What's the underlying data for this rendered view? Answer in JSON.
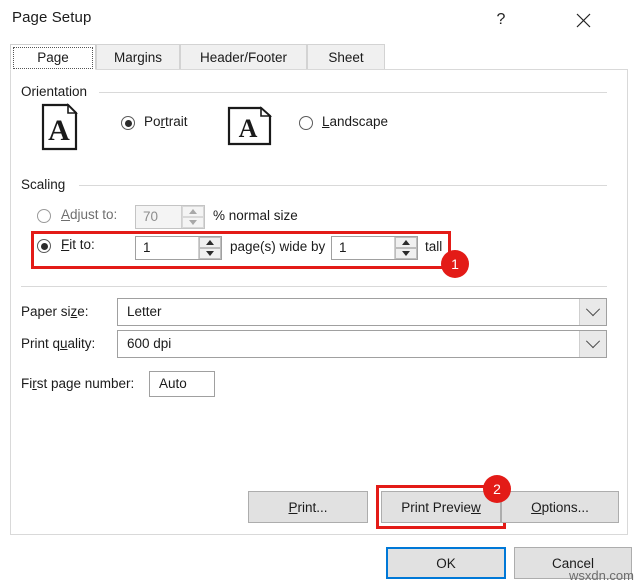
{
  "window": {
    "title": "Page Setup",
    "help_icon": "question-mark-icon",
    "close_icon": "close-icon"
  },
  "tabs": [
    {
      "label": "Page",
      "active": true
    },
    {
      "label": "Margins",
      "active": false
    },
    {
      "label": "Header/Footer",
      "active": false
    },
    {
      "label": "Sheet",
      "active": false
    }
  ],
  "orientation": {
    "group_label": "Orientation",
    "portrait": {
      "label": "Portrait",
      "accel": "r",
      "selected": true,
      "icon": "portrait-page-icon"
    },
    "landscape": {
      "label": "Landscape",
      "accel": "L",
      "selected": false,
      "icon": "landscape-page-icon"
    }
  },
  "scaling": {
    "group_label": "Scaling",
    "adjust_to": {
      "label": "Adjust to:",
      "accel": "A",
      "selected": false,
      "enabled": false,
      "value": "70",
      "suffix": "% normal size"
    },
    "fit_to": {
      "label": "Fit to:",
      "accel": "F",
      "selected": true,
      "enabled": true,
      "pages_wide": "1",
      "middle_text": "page(s) wide by",
      "pages_tall": "1",
      "suffix": "tall"
    }
  },
  "paper_size": {
    "label": "Paper size:",
    "accel": "z",
    "value": "Letter",
    "arrow_icon": "chevron-down-icon"
  },
  "print_quality": {
    "label": "Print quality:",
    "accel": "u",
    "value": "600 dpi",
    "arrow_icon": "chevron-down-icon"
  },
  "first_page_number": {
    "label": "First page number:",
    "accel": "r",
    "value": "Auto"
  },
  "action_buttons": {
    "print": "Print...",
    "print_accel": "P",
    "print_preview": "Print Preview",
    "print_preview_accel": "w",
    "options": "Options...",
    "options_accel": "O"
  },
  "footer_buttons": {
    "ok": "OK",
    "cancel": "Cancel"
  },
  "annotations": [
    {
      "number": "1",
      "target": "fit-to-row"
    },
    {
      "number": "2",
      "target": "print-preview-button"
    }
  ],
  "watermark": "wsxdn.com",
  "colors": {
    "annotation_red": "#e31b17",
    "default_button_blue": "#0078d7",
    "dialog_background": "#ffffff",
    "button_face": "#e1e1e1"
  }
}
